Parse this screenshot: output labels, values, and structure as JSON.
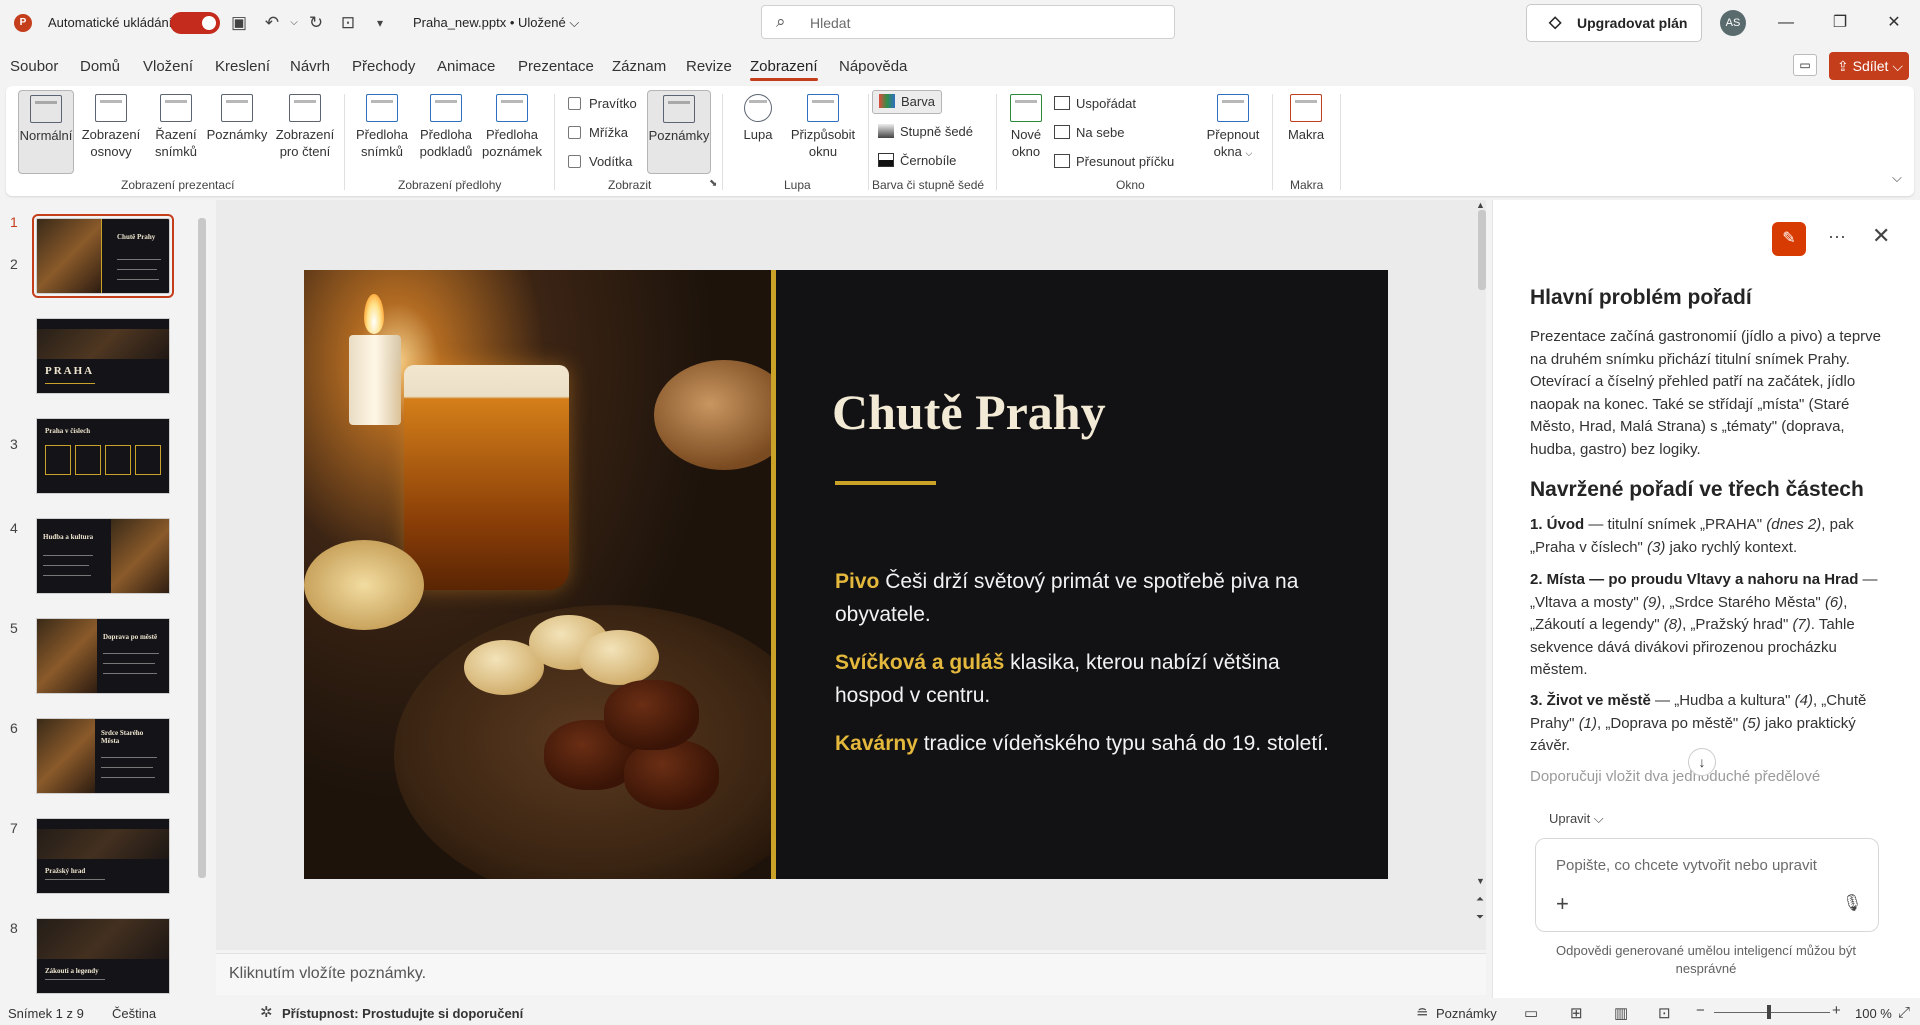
{
  "titlebar": {
    "autosave_label": "Automatické ukládání",
    "file_name": "Praha_new.pptx • Uložené ⌵",
    "search_placeholder": "Hledat",
    "upgrade_label": "Upgradovat plán",
    "avatar_initials": "AS"
  },
  "menu": {
    "items": [
      "Soubor",
      "Domů",
      "Vložení",
      "Kreslení",
      "Návrh",
      "Přechody",
      "Animace",
      "Prezentace",
      "Záznam",
      "Revize",
      "Zobrazení",
      "Nápověda"
    ],
    "active": "Zobrazení",
    "share_label": "Sdílet"
  },
  "ribbon": {
    "presentation_views": {
      "group_label": "Zobrazení prezentací",
      "buttons": [
        "Normální",
        "Zobrazení osnovy",
        "Řazení snímků",
        "Poznámky",
        "Zobrazení pro čtení"
      ]
    },
    "master_views": {
      "group_label": "Zobrazení předlohy",
      "buttons": [
        "Předloha snímků",
        "Předloha podkladů",
        "Předloha poznámek"
      ]
    },
    "show": {
      "group_label": "Zobrazit",
      "checkboxes": [
        "Pravítko",
        "Mřížka",
        "Vodítka"
      ],
      "notes_button": "Poznámky"
    },
    "zoom": {
      "group_label": "Lupa",
      "buttons": [
        "Lupa",
        "Přizpůsobit oknu"
      ]
    },
    "color": {
      "group_label": "Barva či stupně šedé",
      "options": [
        "Barva",
        "Stupně šedé",
        "Černobíle"
      ]
    },
    "window": {
      "group_label": "Okno",
      "new_window": "Nové okno",
      "options": [
        "Uspořádat",
        "Na sebe",
        "Přesunout příčku"
      ],
      "switch": "Přepnout okna"
    },
    "macros": {
      "group_label": "Makra",
      "button": "Makra"
    }
  },
  "thumbnails": [
    {
      "num": "1",
      "title": "Chutě Prahy"
    },
    {
      "num": "2",
      "title": "PRAHA"
    },
    {
      "num": "3",
      "title": "Praha v číslech"
    },
    {
      "num": "4",
      "title": "Hudba a kultura"
    },
    {
      "num": "5",
      "title": "Doprava po městě"
    },
    {
      "num": "6",
      "title": "Srdce Starého Města"
    },
    {
      "num": "7",
      "title": "Pražský hrad"
    },
    {
      "num": "8",
      "title": "Zákoutí a legendy"
    }
  ],
  "slide": {
    "title": "Chutě Prahy",
    "points": [
      {
        "highlight": "Pivo",
        "text": " Češi drží světový primát ve spotřebě piva na obyvatele."
      },
      {
        "highlight": "Svíčková a guláš",
        "text": " klasika, kterou nabízí většina hospod v centru."
      },
      {
        "highlight": "Kavárny",
        "text": " tradice vídeňského typu sahá do 19. století."
      }
    ]
  },
  "notes_placeholder": "Kliknutím vložíte poznámky.",
  "copilot": {
    "heading1": "Hlavní problém pořadí",
    "para1": "Prezentace začíná gastronomií (jídlo a pivo) a teprve na druhém snímku přichází titulní snímek Prahy. Otevírací a číselný přehled patří na začátek, jídlo naopak na konec. Také se střídají „místa\" (Staré Město, Hrad, Malá Strana) s „tématy\" (doprava, hudba, gastro) bez logiky.",
    "heading2": "Navržené pořadí ve třech částech",
    "item1_bold": "1. Úvod",
    "item1_text": " — titulní snímek „PRAHA\" ",
    "item1_i1": "(dnes 2)",
    "item1_text2": ", pak „Praha v číslech\" ",
    "item1_i2": "(3)",
    "item1_text3": " jako rychlý kontext.",
    "item2_bold": "2. Místa — po proudu Vltavy a nahoru na Hrad",
    "item2_text": " — „Vltava a mosty\" ",
    "item2_i1": "(9)",
    "item2_text2": ", „Srdce Starého Města\" ",
    "item2_i2": "(6)",
    "item2_text3": ", „Zákoutí a legendy\" ",
    "item2_i3": "(8)",
    "item2_text4": ", „Pražský hrad\" ",
    "item2_i4": "(7)",
    "item2_text5": ". Tahle sekvence dává divákovi přirozenou procházku městem.",
    "item3_bold": "3. Život ve městě",
    "item3_text": " — „Hudba a kultura\" ",
    "item3_i1": "(4)",
    "item3_text2": ", „Chutě Prahy\" ",
    "item3_i2": "(1)",
    "item3_text3": ", „Doprava po městě\" ",
    "item3_i3": "(5)",
    "item3_text4": " jako praktický závěr.",
    "faded": "Doporučuji vložit dva jednoduché předělové",
    "edit_label": "Upravit ⌵",
    "input_placeholder": "Popište, co chcete vytvořit nebo upravit",
    "disclaimer": "Odpovědi generované umělou inteligencí můžou být nesprávné"
  },
  "status": {
    "slide_info": "Snímek 1 z 9",
    "language": "Čeština",
    "accessibility": "Přístupnost: Prostudujte si doporučení",
    "notes": "Poznámky",
    "zoom": "100 %"
  }
}
